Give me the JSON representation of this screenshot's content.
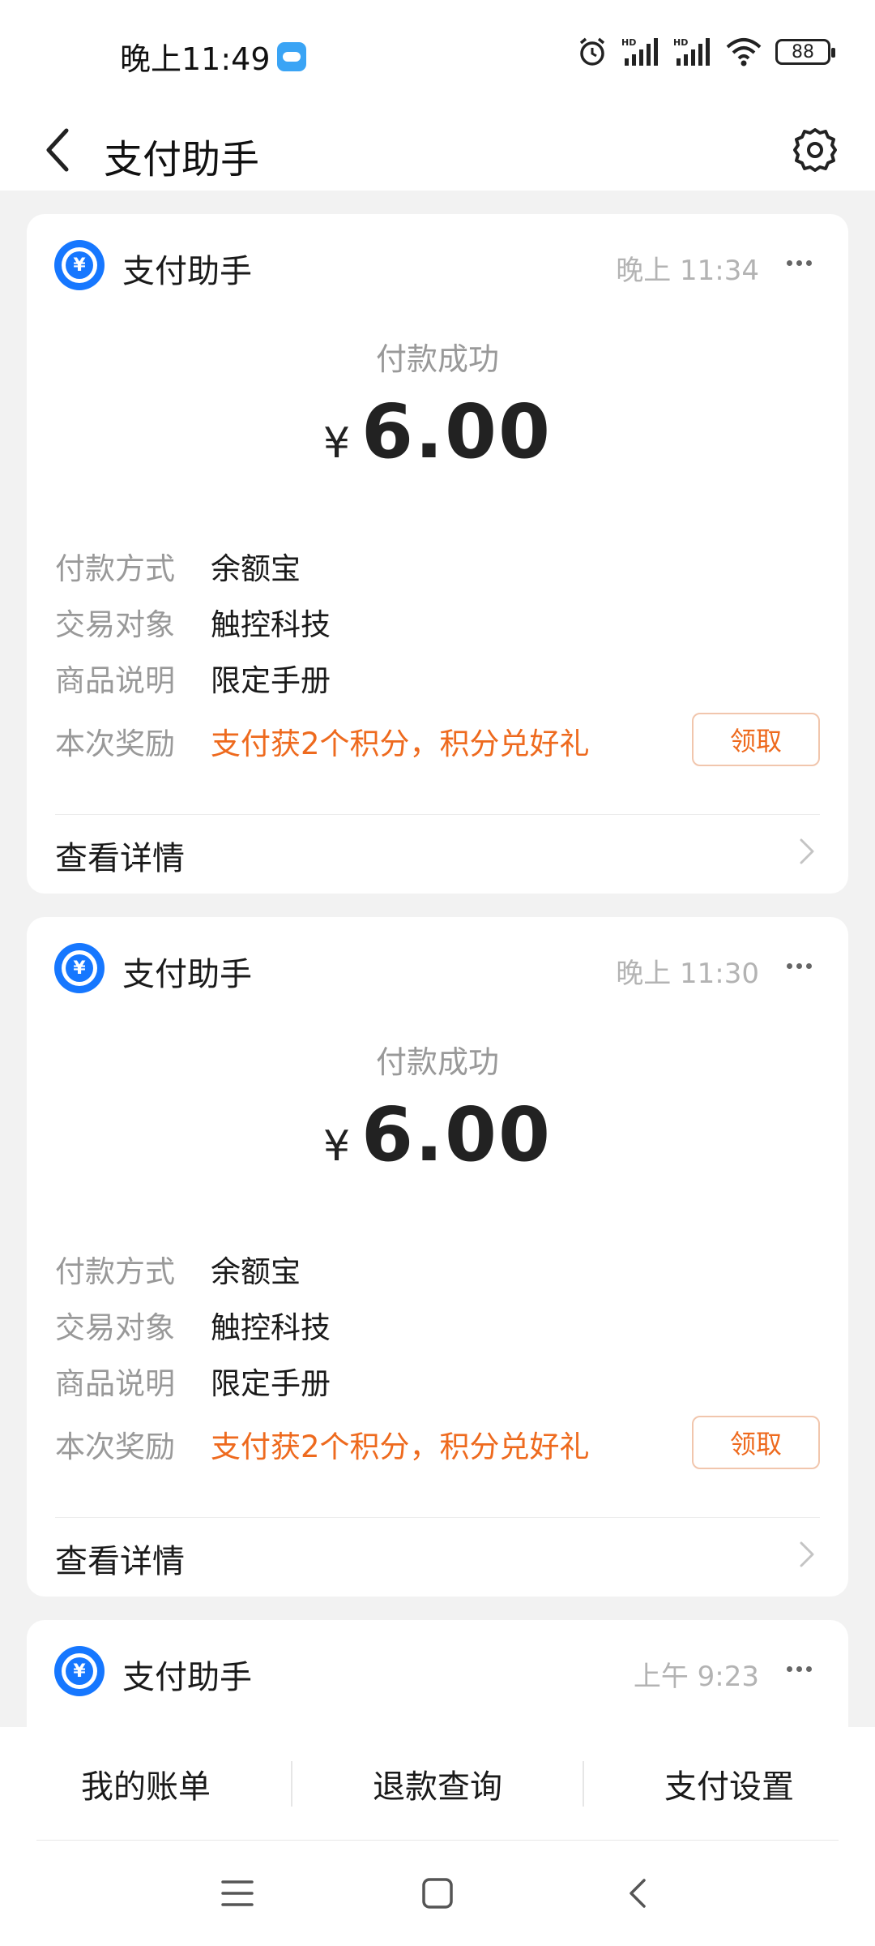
{
  "status_bar": {
    "time": "晚上11:49",
    "battery": "88"
  },
  "header": {
    "title": "支付助手"
  },
  "cards": [
    {
      "app_name": "支付助手",
      "time": "晚上 11:34",
      "status": "付款成功",
      "currency": "¥",
      "amount": "6.00",
      "rows": [
        {
          "label": "付款方式",
          "value": "余额宝"
        },
        {
          "label": "交易对象",
          "value": "触控科技"
        },
        {
          "label": "商品说明",
          "value": "限定手册"
        }
      ],
      "reward_label": "本次奖励",
      "reward_value": "支付获2个积分，积分兑好礼",
      "claim_label": "领取",
      "details_label": "查看详情"
    },
    {
      "app_name": "支付助手",
      "time": "晚上 11:30",
      "status": "付款成功",
      "currency": "¥",
      "amount": "6.00",
      "rows": [
        {
          "label": "付款方式",
          "value": "余额宝"
        },
        {
          "label": "交易对象",
          "value": "触控科技"
        },
        {
          "label": "商品说明",
          "value": "限定手册"
        }
      ],
      "reward_label": "本次奖励",
      "reward_value": "支付获2个积分，积分兑好礼",
      "claim_label": "领取",
      "details_label": "查看详情"
    },
    {
      "app_name": "支付助手",
      "time": "上午 9:23"
    }
  ],
  "bottom_menu": {
    "items": [
      "我的账单",
      "退款查询",
      "支付设置"
    ]
  },
  "colors": {
    "accent_blue": "#1677ff",
    "reward_orange": "#ee6a1e",
    "background": "#f2f2f2"
  }
}
